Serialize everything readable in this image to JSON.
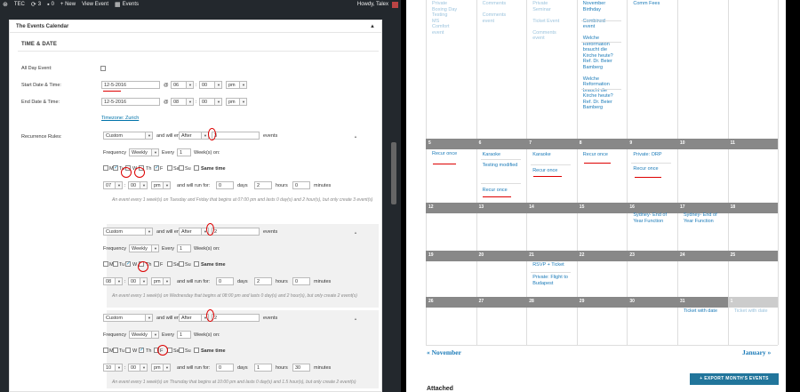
{
  "adminbar": {
    "site": "TEC",
    "updates": "3",
    "comments": "0",
    "new": "+ New",
    "view": "View Event",
    "events": "Events",
    "howdy": "Howdy, Talex"
  },
  "panel": {
    "title": "The Events Calendar",
    "section": "TIME & DATE",
    "all_day": "All Day Event:",
    "start": "Start Date & Time:",
    "end": "End Date & Time:",
    "start_date": "12-5-2016",
    "at": "@",
    "start_hour": "06",
    "start_min": "00",
    "start_ampm": "pm",
    "end_date": "12-5-2016",
    "end_hour": "08",
    "end_min": "00",
    "end_ampm": "pm",
    "timezone": "Timezone: Zurich",
    "recurrence": "Recurrence Rules:"
  },
  "rules": [
    {
      "type": "Custom",
      "and_will_end": "and will end",
      "end": "After",
      "count": "3",
      "events": "events",
      "frequency": "Frequency",
      "freq": "Weekly",
      "every": "Every",
      "every_n": "1",
      "weeks_on": "Week(s) on:",
      "days": [
        "M",
        "Tu",
        "W",
        "Th",
        "F",
        "Sa",
        "Su"
      ],
      "checked": [
        false,
        true,
        false,
        false,
        true,
        false,
        false
      ],
      "same_time": "Same time",
      "hour": "07",
      "min": "00",
      "ampm": "pm",
      "will_run": "and will run for:",
      "d": "0",
      "days_lbl": "days",
      "h": "2",
      "hours_lbl": "hours",
      "m": "0",
      "minutes_lbl": "minutes",
      "desc": "An event every 1 week(s) on Tuesday and Friday that begins at 07:00 pm and lasts 0 day(s) and 2 hour(s), but only create 3 event(s)"
    },
    {
      "type": "Custom",
      "and_will_end": "and will end",
      "end": "After",
      "count": "2",
      "events": "events",
      "frequency": "Frequency",
      "freq": "Weekly",
      "every": "Every",
      "every_n": "1",
      "weeks_on": "Week(s) on:",
      "days": [
        "M",
        "Tu",
        "W",
        "Th",
        "F",
        "Sa",
        "Su"
      ],
      "checked": [
        false,
        false,
        true,
        false,
        false,
        false,
        false
      ],
      "same_time": "Same time",
      "hour": "08",
      "min": "00",
      "ampm": "pm",
      "will_run": "and will run for:",
      "d": "0",
      "days_lbl": "days",
      "h": "2",
      "hours_lbl": "hours",
      "m": "0",
      "minutes_lbl": "minutes",
      "desc": "An event every 1 week(s) on Wednesday that begins at 08:00 pm and lasts 0 day(s) and 2 hour(s), but only create 2 event(s)"
    },
    {
      "type": "Custom",
      "and_will_end": "and will end",
      "end": "After",
      "count": "2",
      "events": "events",
      "frequency": "Frequency",
      "freq": "Weekly",
      "every": "Every",
      "every_n": "1",
      "weeks_on": "Week(s) on:",
      "days": [
        "M",
        "Tu",
        "W",
        "Th",
        "F",
        "Sa",
        "Su"
      ],
      "checked": [
        false,
        false,
        false,
        true,
        false,
        false,
        false
      ],
      "same_time": "Same time",
      "hour": "10",
      "min": "00",
      "ampm": "pm",
      "will_run": "and will run for:",
      "d": "0",
      "days_lbl": "days",
      "h": "1",
      "hours_lbl": "hours",
      "m": "30",
      "minutes_lbl": "minutes",
      "desc": "An event every 1 week(s) on Thursday that begins at 10:00 pm and lasts 0 day(s) and 1.5 hour(s), but only create 2 event(s)"
    }
  ],
  "calendar": {
    "top_events": {
      "c0": [
        "Private",
        "Boxing Day",
        "Testing",
        "MS",
        "Comfort",
        "event"
      ],
      "c1": [
        "Comments",
        "",
        "Comments",
        "event"
      ],
      "c2": [
        "Private",
        "Seminar",
        "",
        "Ticket Event",
        "",
        "Comments",
        "event"
      ],
      "c3": [
        "November",
        "Birthday",
        "",
        "Combined",
        "event",
        "",
        "Welche",
        "Reformation",
        "braucht die",
        "Kirche heute?",
        "Ref. Dr. Beier",
        "Bamberg",
        "",
        "Welche",
        "Reformation",
        "braucht die",
        "Kirche heute?",
        "Ref. Dr. Beier",
        "Bamberg"
      ],
      "c4": [
        "Comm Fees"
      ]
    },
    "weeks": [
      {
        "days": [
          "5",
          "6",
          "7",
          "8",
          "9",
          "10",
          "11"
        ],
        "events": [
          [
            "Recur once"
          ],
          [
            "Karaoke",
            "Testing modified",
            "Recur once"
          ],
          [
            "Karaoke",
            "Recur once"
          ],
          [
            "Recur once"
          ],
          [
            "Private: ORP",
            "Recur once"
          ],
          [],
          []
        ]
      },
      {
        "days": [
          "12",
          "13",
          "14",
          "15",
          "16",
          "17",
          "18"
        ],
        "events": [
          [],
          [],
          [],
          [],
          [
            "Sydney- End of Year Function"
          ],
          [
            "Sydney- End of Year Function"
          ],
          []
        ]
      },
      {
        "days": [
          "19",
          "20",
          "21",
          "22",
          "23",
          "24",
          "25"
        ],
        "events": [
          [],
          [],
          [
            "RSVP + Ticket",
            "Private: Flight to Budapest"
          ],
          [],
          [],
          [],
          []
        ]
      },
      {
        "days": [
          "26",
          "27",
          "28",
          "29",
          "30",
          "31",
          "1"
        ],
        "events": [
          [],
          [],
          [],
          [],
          [],
          [
            "Ticket with date"
          ],
          [
            "Ticket with date"
          ]
        ]
      }
    ],
    "prev": "« November",
    "next": "January »",
    "export": "+ EXPORT MONTH'S EVENTS",
    "bottom": "Attached"
  },
  "colors": {
    "admin": "#23282d",
    "link": "#1a7ab8",
    "daybar": "#888888",
    "export": "#21759b",
    "annotation": "#dd0000"
  }
}
